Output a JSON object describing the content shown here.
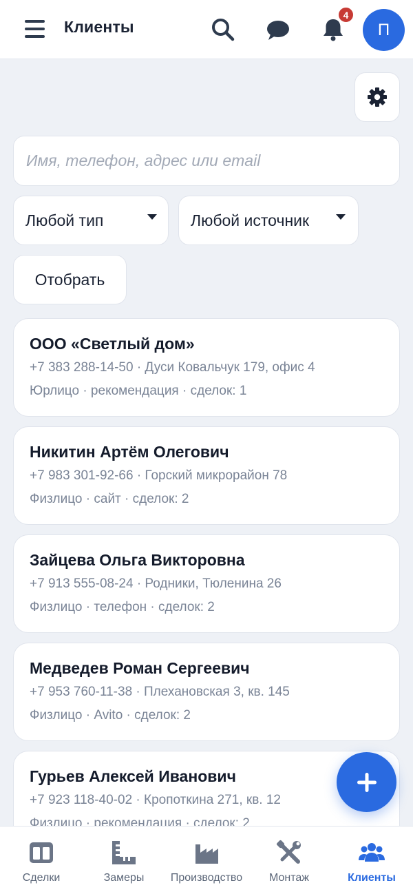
{
  "header": {
    "title": "Клиенты",
    "notification_count": "4",
    "avatar_initial": "П",
    "icons": {
      "menu": "hamburger-icon",
      "search": "search-icon",
      "chat": "chat-icon",
      "notifications": "bell-icon"
    }
  },
  "toolbar": {
    "settings_icon": "gear-icon"
  },
  "search": {
    "placeholder": "Имя, телефон, адрес или email",
    "value": ""
  },
  "filters": {
    "type_select": "Любой тип",
    "source_select": "Любой источник",
    "apply_button": "Отобрать"
  },
  "clients": [
    {
      "name": "ООО «Светлый дом»",
      "contact": "+7 383 288-14-50 · Дуси Ковальчук 179, офис 4",
      "meta": "Юрлицо · рекомендация · сделок: 1"
    },
    {
      "name": "Никитин Артём Олегович",
      "contact": "+7 983 301-92-66 · Горский микрорайон 78",
      "meta": "Физлицо · сайт · сделок: 2"
    },
    {
      "name": "Зайцева Ольга Викторовна",
      "contact": "+7 913 555-08-24 · Родники, Тюленина 26",
      "meta": "Физлицо · телефон · сделок: 2"
    },
    {
      "name": "Медведев Роман Сергеевич",
      "contact": "+7 953 760-11-38 · Плехановская 3, кв. 145",
      "meta": "Физлицо · Avito · сделок: 2"
    },
    {
      "name": "Гурьев Алексей Иванович",
      "contact": "+7 923 118-40-02 · Кропоткина 271, кв. 12",
      "meta": "Физлицо · рекомендация · сделок: 2"
    }
  ],
  "fab": {
    "icon": "plus-icon"
  },
  "bottom_nav": [
    {
      "label": "Сделки",
      "icon": "deals-icon",
      "active": false
    },
    {
      "label": "Замеры",
      "icon": "ruler-icon",
      "active": false
    },
    {
      "label": "Производство",
      "icon": "factory-icon",
      "active": false
    },
    {
      "label": "Монтаж",
      "icon": "tools-icon",
      "active": false
    },
    {
      "label": "Клиенты",
      "icon": "users-icon",
      "active": true
    }
  ],
  "colors": {
    "accent": "#2a6ae0",
    "badge": "#c73a34",
    "background": "#eef1f6",
    "muted_text": "#7a8496",
    "nav_icon": "#6b7587"
  }
}
